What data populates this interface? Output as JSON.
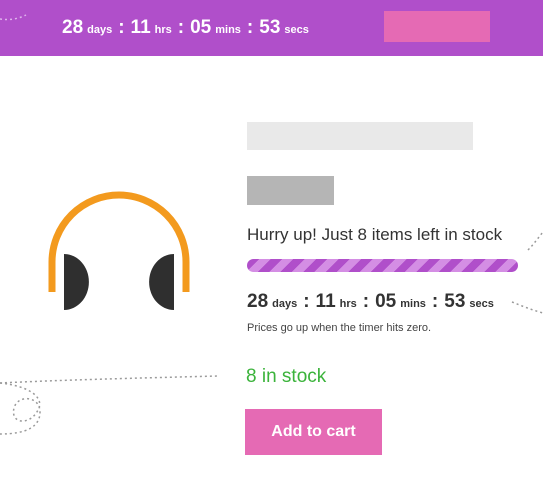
{
  "colors": {
    "brand_purple": "#b04fca",
    "cta_pink": "#e56ab4",
    "stock_green": "#3bb33b",
    "headphone_band": "#f39a1e",
    "headphone_cup": "#2f2f2f"
  },
  "top_bar": {
    "countdown": {
      "days": "28",
      "days_unit": "days",
      "hours": "11",
      "hours_unit": "hrs",
      "minutes": "05",
      "minutes_unit": "mins",
      "seconds": "53",
      "seconds_unit": "secs",
      "separator": ":"
    },
    "button_label": ""
  },
  "product": {
    "image_icon": "headphones-icon",
    "title_placeholder": "",
    "price_placeholder": "",
    "urgency_message": "Hurry up! Just 8 items left in stock",
    "stock_progress_fraction": 1.0,
    "countdown": {
      "days": "28",
      "days_unit": "days",
      "hours": "11",
      "hours_unit": "hrs",
      "minutes": "05",
      "minutes_unit": "mins",
      "seconds": "53",
      "seconds_unit": "secs",
      "separator": ":"
    },
    "countdown_note": "Prices go up when the timer hits zero.",
    "stock_status": "8 in stock",
    "add_to_cart_label": "Add to cart"
  }
}
